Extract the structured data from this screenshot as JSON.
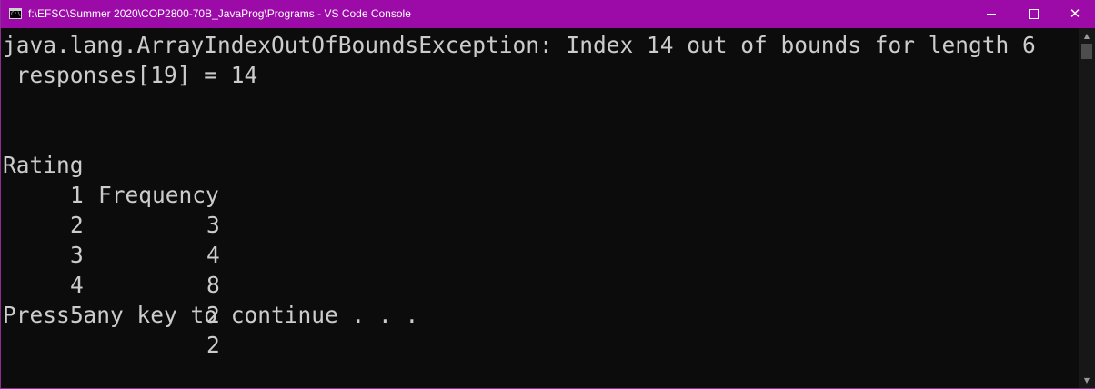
{
  "window": {
    "title": "f:\\EFSC\\Summer 2020\\COP2800-70B_JavaProg\\Programs - VS Code Console",
    "icon_name": "console-app-icon",
    "icon_text": "C:\\.",
    "controls": {
      "minimize_icon": "minimize-icon",
      "maximize_icon": "maximize-icon",
      "close_icon": "close-icon",
      "close_glyph": "✕"
    },
    "accent_color": "#9c0aa7"
  },
  "console": {
    "text_color": "#cccccc",
    "background_color": "#0c0c0c",
    "exception_line": "java.lang.ArrayIndexOutOfBoundsException: Index 14 out of bounds for length 6",
    "responses_line": " responses[19] = 14",
    "table": {
      "headers": [
        "Rating",
        "Frequency"
      ],
      "rows": [
        {
          "rating": "1",
          "frequency": "3"
        },
        {
          "rating": "2",
          "frequency": "4"
        },
        {
          "rating": "3",
          "frequency": "8"
        },
        {
          "rating": "4",
          "frequency": "2"
        },
        {
          "rating": "5",
          "frequency": "2"
        }
      ]
    },
    "prompt_line": "Press any key to continue . . ."
  },
  "scrollbar": {
    "up_arrow": "▲",
    "down_arrow": "▼"
  }
}
